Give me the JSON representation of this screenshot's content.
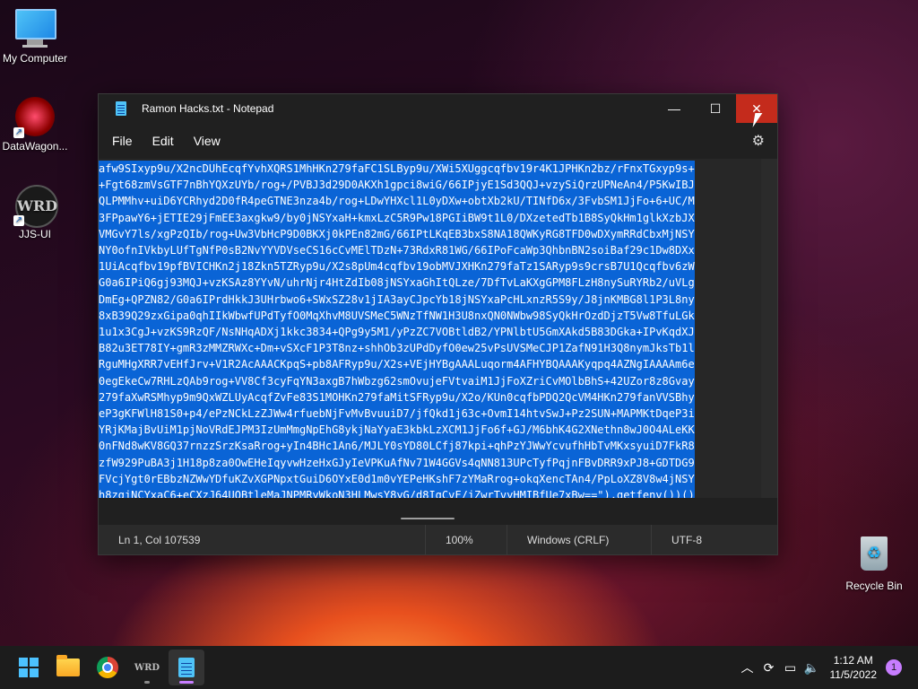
{
  "desktop": {
    "icons": [
      {
        "label": "My Computer"
      },
      {
        "label": "DataWagon..."
      },
      {
        "label": "JJS-UI"
      },
      {
        "label": "Recycle Bin"
      }
    ]
  },
  "window": {
    "title": "Ramon Hacks.txt - Notepad",
    "controls": {
      "minimize": "—",
      "maximize": "☐",
      "close": "✕"
    },
    "menu": [
      "File",
      "Edit",
      "View"
    ],
    "settings_icon": "gear-icon",
    "editor_lines": [
      "afw9SIxyp9u/X2ncDUhEcqfYvhXQRS1MhHKn279faFC1SLByp9u/XWi5XUggcqfbv19r4K1JPHKn2bz/rFnxTGxyp9s+",
      "+Fgt68zmVsGTF7nBhYQXzUYb/rog+/PVBJ3d29D0AKXh1gpci8wiG/66IPjyE1Sd3QQJ+vzySiQrzUPNeAn4/P5KwIBJ",
      "QLPMMhv+uiD6YCRhyd2D0fR4peGTNE3nza4b/rog+LDwYHXcl1L0yDXw+obtXb2kU/TINfD6x/3FvbSM1JjFo+6+UC/M",
      "3FPpawY6+jETIE29jFmEE3axgkw9/by0jNSYxaH+kmxLzC5R9Pw18PGIiBW9t1L0/DXzetedTb1B8SyQkHm1glkXzbJX",
      "VMGvY7ls/xgPzQIb/rog+Uw3VbHcP9D0BKXj0kPEn82mG/66IPtLKqEB3bxS8NA18QWKyRG8TFD0wDXymRRdCbxMjNSY",
      "NY0ofnIVkbyLUfTgNfP0sB2NvYYVDVseCS16cCvMElTDzN+73RdxR81WG/66IPoFcaWp3QhbnBN2soiBaf29c1Dw8DXx",
      "1UiAcqfbv19pfBVICHKn2j18Zkn5TZRyp9u/X2s8pUm4cqfbv19obMVJXHKn279faTz1SARyp9s9crsB7U1Qcqfbv6zW",
      "G0a6IPiQ6gj93MQJ+vzKSAz8YYvN/uhrNjr4HtZdIb08jNSYxaGhItQLze/7DfTvLaKXgGPM8FLzH8nySuRYRb2/uVLg",
      "DmEg+QPZN82/G0a6IPrdHkkJ3UHrbwo6+SWxSZ28v1jIA3ayCJpcYb18jNSYxaPcHLxnzR5S9y/J8jnKMBG8l1P3L8ny",
      "8xB39Q29zxGipa0qhIIkWbwfUPdTyfO0MqXhvM8UVSMeC5WNzTfNW1H3U8nxQN0NWbw98SyQkHrOzdDjzT5Vw8TfuLGk",
      "1u1x3CgJ+vzKS9RzQF/NsNHqADXj1kkc3834+QPg9y5M1/yPzZC7VOBtldB2/YPNlbtU5GmXAkd5B83DGka+IPvKqdXJ",
      "B82u3ET78IY+gmR3zMMZRWXc+Dm+vSXcF1P3T8nz+shhOb3zUPdDyfO0ew25vPsUVSMeCJP1ZafN91H3Q8nymJksTb1l",
      "RguMHgXRR7vEHfJrv+V1R2AcAAACKpqS+pb8AFRyp9u/X2s+VEjHYBgAAALuqorm4AFHYBQAAAKyqpq4AZNgIAAAAm6e",
      "0egEkeCw7RHLzQAb9rog+VV8Cf3cyFqYN3axgB7hWbzg62smOvujeFVtvaiM1JjFoXZriCvMOlbBhS+42UZor8z8Gvay",
      "279faXwRSMhyp9m9QxWZLUyAcqfZvFe83S1MOHKn279faMitSFRyp9u/X2o/KUn0cqfbPDQ2QcVM4HKn279fanVVSBhy",
      "eP3gKFWlH81S0+p4/ePzNCkLzZJWw4rfuebNjFvMvBvuuiD7/jfQkd1j63c+OvmI14htvSwJ+Pz2SUN+MAPMKtDqeP3i",
      "YRjKMajBvUiM1pjNoVRdEJPM3IzUmMmgNpEhG8ykjNaYyaE3kbkLzXCM1JjFo6f+GJ/M6bhK4G2XNethn8wJ0O4ALeKK",
      "0nFNd8wKV8GQ37rnzzSrzKsaRrog+yIn4BHc1An6/MJLY0sYD80LCfj87kpi+qhPzYJWwYcvufhHbTvMKxsyuiD7FkR8",
      "zfW929PuBA3j1H18p8za0OwEHeIqyvwHzeHxGJyIeVPKuAfNv71W4GGVs4qNN813UPcTyfPqjnFBvDRR9xPJ8+GDTDG9",
      "FVcjYgt0rEBbzNZWwYDfuKZvXGPNpxtGuiD6OYxE0d1m0vYEPeHKshF7zYMaRrog+okqXencTAn4/PpLoXZ8V8w4jNSY",
      "h8zqjNCYxaC6+eCXzJ64UOBtleMaJNPMRyWkoN3HLMwsY8yG/d8IgCvF/jZwrTvyHMIBfUe7xBw==\"),getfenv())()"
    ]
  },
  "status": {
    "position": "Ln 1, Col 107539",
    "zoom": "100%",
    "line_ending": "Windows (CRLF)",
    "encoding": "UTF-8"
  },
  "taskbar": {
    "time": "1:12 AM",
    "date": "11/5/2022",
    "notifications": "1",
    "apps": [
      "start-icon",
      "file-explorer-icon",
      "chrome-icon",
      "jjs-ui-icon",
      "notepad-icon"
    ],
    "tray_icons": [
      "chevron-up-icon",
      "network-icon",
      "display-icon",
      "volume-icon"
    ]
  },
  "colors": {
    "selection": "#0a64d6",
    "close_hover": "#c42b1c",
    "accent": "#c77dff"
  }
}
